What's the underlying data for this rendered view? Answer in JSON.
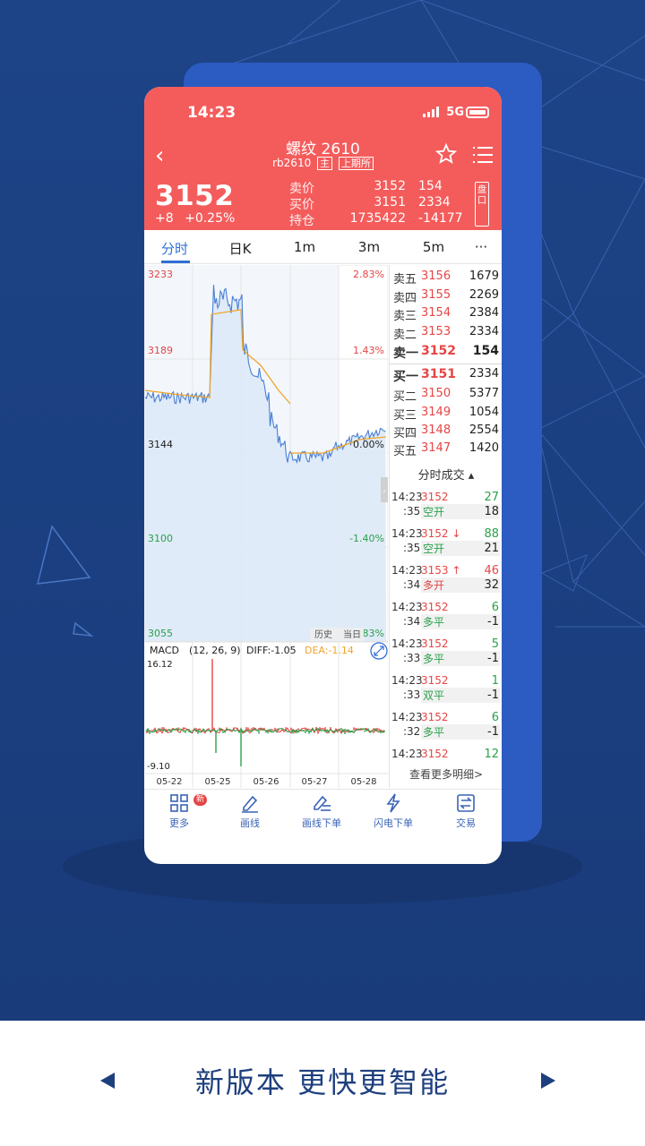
{
  "status": {
    "time": "14:23",
    "network": "5G"
  },
  "header": {
    "title": "螺纹 2610",
    "code": "rb2610",
    "tag_main": "主",
    "exchange": "上期所",
    "price": "3152",
    "change": "+8",
    "change_pct": "+0.25%",
    "quotes": [
      {
        "label": "卖价",
        "a": "3152",
        "b": "154"
      },
      {
        "label": "买价",
        "a": "3151",
        "b": "2334"
      },
      {
        "label": "持仓",
        "a": "1735422",
        "b": "-14177"
      }
    ],
    "side_button": "盘口"
  },
  "tabs": [
    "分时",
    "日K",
    "1m",
    "3m",
    "5m",
    "···"
  ],
  "chart_data": {
    "type": "line",
    "price_axis": {
      "ticks": [
        "3233",
        "3189",
        "3144",
        "3100",
        "3055"
      ],
      "pct_ticks": [
        "2.83%",
        "1.43%",
        "0.00%",
        "-1.40%",
        "-2.83%"
      ]
    },
    "history_label": "历史",
    "current_label": "当日",
    "macd": {
      "label": "MACD",
      "params": "(12, 26, 9)",
      "diff": "DIFF:-1.05",
      "dea": "DEA:-1.14",
      "ymax": "16.12",
      "ymin": "-9.10"
    },
    "dates": [
      "05-22",
      "05-25",
      "05-26",
      "05-27",
      "05-28"
    ],
    "colors": {
      "price": "#4a7fd4",
      "avg": "#f0a52a",
      "up": "#e64545",
      "down": "#2aa14a"
    }
  },
  "orderbook": {
    "asks": [
      {
        "name": "卖五",
        "price": "3156",
        "vol": "1679"
      },
      {
        "name": "卖四",
        "price": "3155",
        "vol": "2269"
      },
      {
        "name": "卖三",
        "price": "3154",
        "vol": "2384"
      },
      {
        "name": "卖二",
        "price": "3153",
        "vol": "2334"
      },
      {
        "name": "卖一",
        "price": "3152",
        "vol": "154"
      }
    ],
    "bids": [
      {
        "name": "买一",
        "price": "3151",
        "vol": "2334"
      },
      {
        "name": "买二",
        "price": "3150",
        "vol": "5377"
      },
      {
        "name": "买三",
        "price": "3149",
        "vol": "1054"
      },
      {
        "name": "买四",
        "price": "3148",
        "vol": "2554"
      },
      {
        "name": "买五",
        "price": "3147",
        "vol": "1420"
      }
    ],
    "ticks_header": "分时成交 ▴",
    "trades": [
      {
        "time": "14:23",
        "sec": ":35",
        "price": "3152",
        "arrow": "",
        "vol": "27",
        "kind": "空开",
        "qty": "18",
        "pcolor": "#e64545",
        "vcolor": "#2aa14a",
        "kcolor": "#2aa14a"
      },
      {
        "time": "14:23",
        "sec": ":35",
        "price": "3152",
        "arrow": "↓",
        "vol": "88",
        "kind": "空开",
        "qty": "21",
        "pcolor": "#e64545",
        "vcolor": "#2aa14a",
        "kcolor": "#2aa14a"
      },
      {
        "time": "14:23",
        "sec": ":34",
        "price": "3153",
        "arrow": "↑",
        "vol": "46",
        "kind": "多开",
        "qty": "32",
        "pcolor": "#e64545",
        "vcolor": "#e64545",
        "kcolor": "#e64545"
      },
      {
        "time": "14:23",
        "sec": ":34",
        "price": "3152",
        "arrow": "",
        "vol": "6",
        "kind": "多平",
        "qty": "-1",
        "pcolor": "#e64545",
        "vcolor": "#2aa14a",
        "kcolor": "#2aa14a"
      },
      {
        "time": "14:23",
        "sec": ":33",
        "price": "3152",
        "arrow": "",
        "vol": "5",
        "kind": "多平",
        "qty": "-1",
        "pcolor": "#e64545",
        "vcolor": "#2aa14a",
        "kcolor": "#2aa14a"
      },
      {
        "time": "14:23",
        "sec": ":33",
        "price": "3152",
        "arrow": "",
        "vol": "1",
        "kind": "双平",
        "qty": "-1",
        "pcolor": "#e64545",
        "vcolor": "#2aa14a",
        "kcolor": "#2aa14a"
      },
      {
        "time": "14:23",
        "sec": ":32",
        "price": "3152",
        "arrow": "",
        "vol": "6",
        "kind": "多平",
        "qty": "-1",
        "pcolor": "#e64545",
        "vcolor": "#2aa14a",
        "kcolor": "#2aa14a"
      },
      {
        "time": "14:23",
        "sec": "",
        "price": "3152",
        "arrow": "",
        "vol": "12",
        "kind": "",
        "qty": "",
        "pcolor": "#e64545",
        "vcolor": "#2aa14a",
        "kcolor": "#2aa14a"
      }
    ],
    "more_link": "查看更多明细>"
  },
  "nav": [
    {
      "label": "更多",
      "badge": "新",
      "icon": "grid-icon"
    },
    {
      "label": "画线",
      "icon": "pen-icon"
    },
    {
      "label": "画线下单",
      "icon": "draw-order-icon"
    },
    {
      "label": "闪电下单",
      "icon": "lightning-icon"
    },
    {
      "label": "交易",
      "icon": "trade-icon"
    }
  ],
  "footer": {
    "slogan": "新版本 更快更智能"
  }
}
